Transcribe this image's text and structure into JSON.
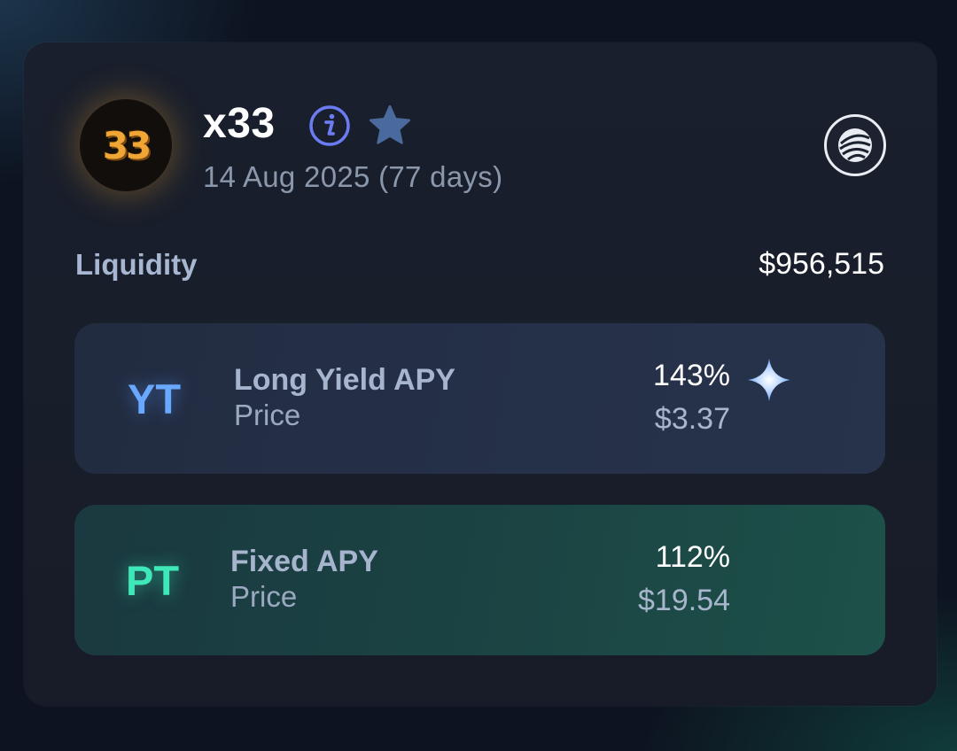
{
  "token": {
    "logo_text": "33",
    "name": "x33",
    "date": "14 Aug 2025 (77 days)",
    "icons": {
      "info": "info-icon",
      "favorite": "star-icon",
      "chain": "chain-network-icon"
    }
  },
  "liquidity": {
    "label": "Liquidity",
    "value": "$956,515"
  },
  "yt": {
    "badge": "YT",
    "label": "Long Yield APY",
    "sublabel": "Price",
    "apy": "143%",
    "price": "$3.37",
    "icon": "sparkle-icon"
  },
  "pt": {
    "badge": "PT",
    "label": "Fixed APY",
    "sublabel": "Price",
    "apy": "112%",
    "price": "$19.54"
  },
  "colors": {
    "yt_accent": "#69a8ff",
    "pt_accent": "#3fe8b8",
    "info_accent": "#6b7cf2",
    "star": "#4a6a9e"
  }
}
